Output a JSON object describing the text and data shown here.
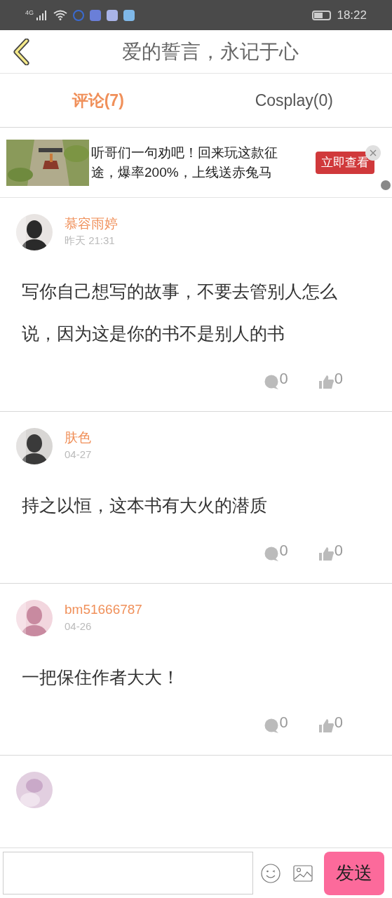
{
  "status_bar": {
    "network": "4G",
    "time": "18:22"
  },
  "header": {
    "title": "爱的誓言，永记于心"
  },
  "tabs": [
    {
      "label": "评论(7)",
      "selected": true
    },
    {
      "label": "Cosplay(0)",
      "selected": false
    }
  ],
  "ad": {
    "text": "听哥们一句劝吧！回来玩这款征途，爆率200%，上线送赤兔马",
    "button": "立即查看"
  },
  "comments": [
    {
      "user": "慕容雨婷",
      "time": "昨天 21:31",
      "text": "写你自己想写的故事，不要去管别人怎么说，因为这是你的书不是别人的书",
      "replies": "0",
      "likes": "0"
    },
    {
      "user": "肤色",
      "time": "04-27",
      "text": "持之以恒，这本书有大火的潜质",
      "replies": "0",
      "likes": "0"
    },
    {
      "user": "bm51666787",
      "time": "04-26",
      "text": "一把保住作者大大！",
      "replies": "0",
      "likes": "0"
    }
  ],
  "composer": {
    "send": "发送"
  }
}
